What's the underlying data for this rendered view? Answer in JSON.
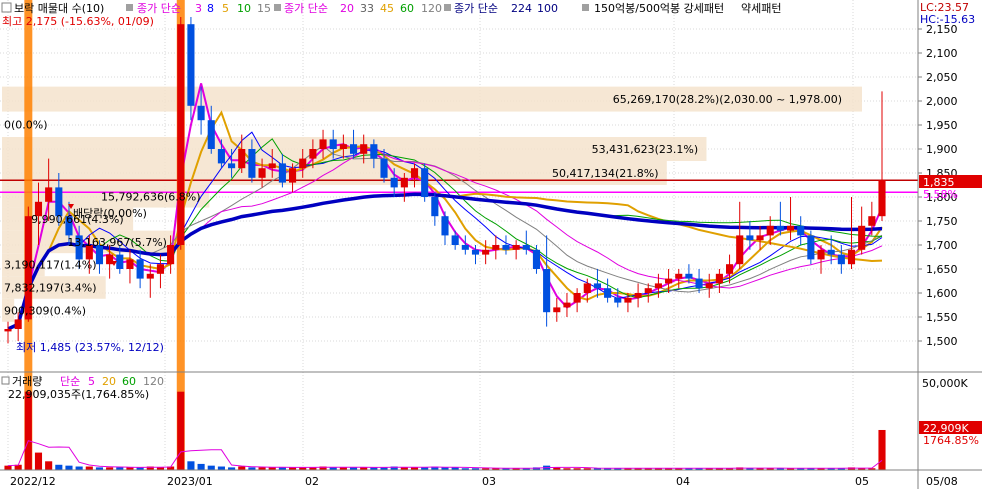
{
  "legend": {
    "title": "보락 매물대 수(10)",
    "ma_label": "종가 단순",
    "ma_periods": [
      {
        "p": "3",
        "color": "#e000e0"
      },
      {
        "p": "8",
        "color": "#0000ff"
      },
      {
        "p": "5",
        "color": "#e0a000"
      },
      {
        "p": "10",
        "color": "#00a000"
      },
      {
        "p": "15",
        "color": "#808080"
      }
    ],
    "ma_label2": "종가 단순",
    "ma_periods2": [
      {
        "p": "20",
        "color": "#e000e0"
      },
      {
        "p": "33",
        "color": "#606060"
      },
      {
        "p": "45",
        "color": "#e0a000"
      },
      {
        "p": "60",
        "color": "#00a000"
      },
      {
        "p": "120",
        "color": "#808080"
      }
    ],
    "ma_label3": "종가 단순",
    "ma_periods3": [
      {
        "p": "224",
        "color": "#000080"
      },
      {
        "p": "100",
        "color": "#000080"
      }
    ],
    "pattern_label": "150억봉/500억봉 강세패턴",
    "weak_label": "약세패턴",
    "lc": "LC:23.57",
    "hc": "HC:-15.63"
  },
  "annotations": {
    "high": "최고 2,175 (-15.63%, 01/09)",
    "low": "최저 1,485 (23.57%, 12/12)",
    "dividend": "배당락(0.00%)",
    "vol_current": "22,909,035주(1,764.85%)"
  },
  "volume_legend": {
    "label": "거래량",
    "ma_label": "단순",
    "periods": [
      {
        "p": "5",
        "color": "#e000e0"
      },
      {
        "p": "20",
        "color": "#e0a000"
      },
      {
        "p": "60",
        "color": "#00a000"
      },
      {
        "p": "120",
        "color": "#808080"
      }
    ]
  },
  "price_axis": {
    "ticks": [
      "2,150",
      "2,100",
      "2,050",
      "2,000",
      "1,950",
      "1,900",
      "1,850",
      "1,800",
      "1,750",
      "1,700",
      "1,650",
      "1,600",
      "1,550",
      "1,500"
    ],
    "current_price": "1,835",
    "current_pct": "5.58%"
  },
  "volume_axis": {
    "top": "50,000K",
    "current": "22,909K",
    "current_pct": "1764.85%"
  },
  "x_axis": {
    "labels": [
      "2022/12",
      "2023/01",
      "02",
      "03",
      "04",
      "05",
      "05/08"
    ]
  },
  "chart_data": {
    "type": "candlestick",
    "y_range": [
      1485,
      2175
    ],
    "x_labels": [
      "2022/12",
      "2023/01",
      "02",
      "03",
      "04",
      "05"
    ],
    "volume_profile": [
      {
        "label": "65,269,170(28.2%)(2,030.00 ~ 1,978.00)",
        "price_low": 1978,
        "price_high": 2030,
        "share": 28.2
      },
      {
        "label": "53,431,623(23.1%)",
        "price_low": 1875,
        "price_high": 1925,
        "share": 23.1
      },
      {
        "label": "50,417,134(21.8%)",
        "price_low": 1825,
        "price_high": 1875,
        "share": 21.8
      },
      {
        "label": "15,792,636(6.8%)",
        "price_low": 1778,
        "price_high": 1825,
        "share": 6.8
      },
      {
        "label": "9,990,661(4.3%)",
        "price_low": 1730,
        "price_high": 1778,
        "share": 4.3
      },
      {
        "label": "13,163,967(5.7%)",
        "price_low": 1683,
        "price_high": 1730,
        "share": 5.7
      },
      {
        "label": "3,190,117(1.4%)",
        "price_low": 1635,
        "price_high": 1683,
        "share": 1.4
      },
      {
        "label": "7,832,197(3.4%)",
        "price_low": 1588,
        "price_high": 1635,
        "share": 3.4
      },
      {
        "label": "900,309(0.4%)",
        "price_low": 1540,
        "price_high": 1588,
        "share": 0.4
      },
      {
        "label": "0(0.0%)",
        "price_low": 1925,
        "price_high": 1978,
        "share": 0.0
      }
    ],
    "hlines": [
      {
        "price": 1835,
        "color": "#c00000"
      },
      {
        "price": 1810,
        "color": "#ff00ff"
      }
    ],
    "candles": [
      [
        1520,
        1540,
        1495,
        1525
      ],
      [
        1525,
        1560,
        1500,
        1545
      ],
      [
        1545,
        1780,
        1540,
        1760
      ],
      [
        1760,
        1830,
        1700,
        1790
      ],
      [
        1790,
        1880,
        1750,
        1820
      ],
      [
        1820,
        1850,
        1740,
        1760
      ],
      [
        1760,
        1790,
        1700,
        1720
      ],
      [
        1720,
        1740,
        1650,
        1670
      ],
      [
        1670,
        1720,
        1640,
        1700
      ],
      [
        1700,
        1710,
        1640,
        1660
      ],
      [
        1660,
        1700,
        1630,
        1680
      ],
      [
        1680,
        1700,
        1640,
        1650
      ],
      [
        1650,
        1690,
        1620,
        1670
      ],
      [
        1670,
        1690,
        1610,
        1630
      ],
      [
        1630,
        1660,
        1590,
        1640
      ],
      [
        1640,
        1680,
        1610,
        1660
      ],
      [
        1660,
        1720,
        1640,
        1700
      ],
      [
        1700,
        2175,
        1690,
        2160
      ],
      [
        2160,
        2175,
        1960,
        1990
      ],
      [
        1990,
        2030,
        1930,
        1960
      ],
      [
        1960,
        1990,
        1890,
        1900
      ],
      [
        1900,
        1920,
        1860,
        1870
      ],
      [
        1870,
        1900,
        1840,
        1860
      ],
      [
        1860,
        1930,
        1850,
        1900
      ],
      [
        1900,
        1920,
        1830,
        1840
      ],
      [
        1840,
        1880,
        1820,
        1860
      ],
      [
        1860,
        1900,
        1840,
        1870
      ],
      [
        1870,
        1890,
        1820,
        1830
      ],
      [
        1830,
        1870,
        1810,
        1860
      ],
      [
        1860,
        1900,
        1840,
        1880
      ],
      [
        1880,
        1920,
        1860,
        1900
      ],
      [
        1900,
        1940,
        1880,
        1920
      ],
      [
        1920,
        1940,
        1880,
        1900
      ],
      [
        1900,
        1930,
        1880,
        1910
      ],
      [
        1910,
        1940,
        1880,
        1890
      ],
      [
        1890,
        1930,
        1870,
        1910
      ],
      [
        1910,
        1920,
        1860,
        1880
      ],
      [
        1880,
        1900,
        1830,
        1840
      ],
      [
        1840,
        1860,
        1800,
        1820
      ],
      [
        1820,
        1850,
        1790,
        1840
      ],
      [
        1840,
        1870,
        1820,
        1860
      ],
      [
        1860,
        1870,
        1790,
        1800
      ],
      [
        1800,
        1810,
        1740,
        1760
      ],
      [
        1760,
        1770,
        1700,
        1720
      ],
      [
        1720,
        1730,
        1690,
        1700
      ],
      [
        1700,
        1720,
        1680,
        1690
      ],
      [
        1690,
        1700,
        1660,
        1680
      ],
      [
        1680,
        1710,
        1660,
        1690
      ],
      [
        1690,
        1720,
        1670,
        1700
      ],
      [
        1700,
        1720,
        1680,
        1690
      ],
      [
        1690,
        1710,
        1670,
        1700
      ],
      [
        1700,
        1730,
        1680,
        1690
      ],
      [
        1690,
        1700,
        1640,
        1650
      ],
      [
        1650,
        1720,
        1530,
        1560
      ],
      [
        1560,
        1590,
        1540,
        1570
      ],
      [
        1570,
        1600,
        1550,
        1580
      ],
      [
        1580,
        1610,
        1560,
        1600
      ],
      [
        1600,
        1630,
        1580,
        1620
      ],
      [
        1620,
        1650,
        1590,
        1610
      ],
      [
        1610,
        1630,
        1580,
        1590
      ],
      [
        1590,
        1610,
        1570,
        1580
      ],
      [
        1580,
        1600,
        1560,
        1590
      ],
      [
        1590,
        1620,
        1570,
        1600
      ],
      [
        1600,
        1620,
        1580,
        1610
      ],
      [
        1610,
        1640,
        1590,
        1620
      ],
      [
        1620,
        1650,
        1600,
        1630
      ],
      [
        1630,
        1650,
        1610,
        1640
      ],
      [
        1640,
        1660,
        1620,
        1630
      ],
      [
        1630,
        1650,
        1600,
        1610
      ],
      [
        1610,
        1640,
        1590,
        1620
      ],
      [
        1620,
        1650,
        1600,
        1640
      ],
      [
        1640,
        1680,
        1620,
        1660
      ],
      [
        1660,
        1790,
        1650,
        1720
      ],
      [
        1720,
        1750,
        1690,
        1710
      ],
      [
        1710,
        1740,
        1690,
        1720
      ],
      [
        1720,
        1760,
        1700,
        1740
      ],
      [
        1740,
        1790,
        1720,
        1730
      ],
      [
        1730,
        1800,
        1710,
        1740
      ],
      [
        1740,
        1760,
        1700,
        1720
      ],
      [
        1720,
        1730,
        1660,
        1670
      ],
      [
        1670,
        1700,
        1640,
        1690
      ],
      [
        1690,
        1720,
        1660,
        1680
      ],
      [
        1680,
        1700,
        1640,
        1660
      ],
      [
        1660,
        1800,
        1650,
        1690
      ],
      [
        1690,
        1780,
        1680,
        1740
      ],
      [
        1740,
        1790,
        1720,
        1760
      ],
      [
        1760,
        2020,
        1750,
        1835
      ]
    ],
    "volume_share": [
      0.05,
      0.06,
      0.9,
      0.2,
      0.1,
      0.06,
      0.05,
      0.04,
      0.04,
      0.03,
      0.03,
      0.03,
      0.03,
      0.03,
      0.04,
      0.03,
      0.04,
      0.9,
      0.1,
      0.07,
      0.05,
      0.04,
      0.03,
      0.04,
      0.03,
      0.03,
      0.03,
      0.03,
      0.03,
      0.03,
      0.03,
      0.04,
      0.03,
      0.03,
      0.03,
      0.03,
      0.03,
      0.03,
      0.04,
      0.03,
      0.03,
      0.03,
      0.04,
      0.03,
      0.03,
      0.02,
      0.02,
      0.02,
      0.02,
      0.02,
      0.02,
      0.02,
      0.03,
      0.05,
      0.03,
      0.02,
      0.02,
      0.02,
      0.02,
      0.02,
      0.02,
      0.02,
      0.02,
      0.02,
      0.02,
      0.02,
      0.02,
      0.02,
      0.02,
      0.02,
      0.02,
      0.02,
      0.03,
      0.02,
      0.02,
      0.02,
      0.02,
      0.02,
      0.02,
      0.02,
      0.02,
      0.02,
      0.02,
      0.03,
      0.02,
      0.02,
      0.46
    ]
  }
}
